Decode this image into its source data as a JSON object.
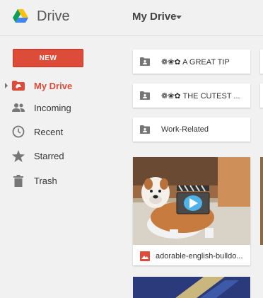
{
  "header": {
    "app_title": "Drive",
    "current_folder": "My Drive"
  },
  "sidebar": {
    "new_label": "NEW",
    "items": [
      {
        "label": "My Drive",
        "icon": "drive-folder-icon",
        "active": true
      },
      {
        "label": "Incoming",
        "icon": "people-icon"
      },
      {
        "label": "Recent",
        "icon": "clock-icon"
      },
      {
        "label": "Starred",
        "icon": "star-icon"
      },
      {
        "label": "Trash",
        "icon": "trash-icon"
      }
    ]
  },
  "folders": [
    {
      "name": "❁❀✿ A GREAT TIP"
    },
    {
      "name": "❁❀✿ THE CUTEST ..."
    },
    {
      "name": "Work-Related"
    }
  ],
  "files": [
    {
      "name": "adorable-english-bulldo...",
      "type": "image"
    }
  ],
  "colors": {
    "accent": "#dd4b39",
    "background": "#f1f1f1"
  }
}
